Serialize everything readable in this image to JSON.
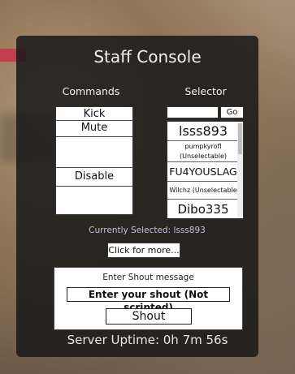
{
  "title": "Staff Console",
  "commands": {
    "header": "Commands",
    "items": [
      "Kick",
      "Mute",
      "",
      "Disable Scripts",
      ""
    ]
  },
  "selector": {
    "header": "Selector",
    "search_value": "",
    "go_label": "Go",
    "players": [
      "lsss893",
      "pumpkyrofl (Unselectable)",
      "FU4YOUSLAG",
      "Wilchz (Unselectable",
      "Dibo335"
    ]
  },
  "current_selection": "Currently Selected: lsss893",
  "click_more_label": "Click for more...",
  "shout": {
    "label": "Enter Shout message",
    "input_value": "Enter your shout (Not scripted)",
    "button_label": "Shout"
  },
  "uptime": "Server Uptime: 0h 7m 56s"
}
